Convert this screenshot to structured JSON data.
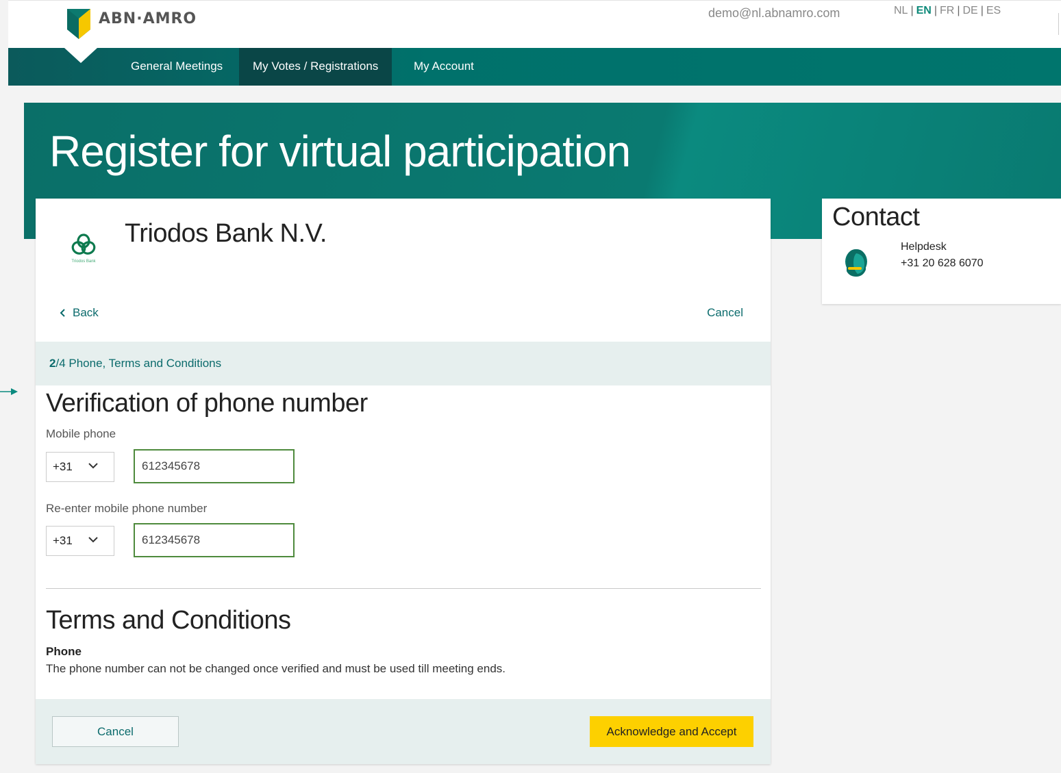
{
  "brand": {
    "name": "ABN·AMRO"
  },
  "header": {
    "user_email": "demo@nl.abnamro.com",
    "languages": [
      {
        "code": "NL",
        "active": false
      },
      {
        "code": "EN",
        "active": true
      },
      {
        "code": "FR",
        "active": false
      },
      {
        "code": "DE",
        "active": false
      },
      {
        "code": "ES",
        "active": false
      }
    ],
    "separator": "|"
  },
  "nav": {
    "items": [
      {
        "label": "General Meetings",
        "active": false
      },
      {
        "label": "My Votes / Registrations",
        "active": true
      },
      {
        "label": "My Account",
        "active": false
      }
    ]
  },
  "hero": {
    "title": "Register for virtual participation"
  },
  "card": {
    "bank_name": "Triodos Bank N.V.",
    "bank_logo_caption": "Triodos Bank",
    "back_label": "Back",
    "cancel_link_label": "Cancel",
    "step": {
      "current": "2",
      "total": "/4",
      "title": "Phone, Terms and Conditions"
    },
    "verification_title": "Verification of phone number",
    "mobile_label": "Mobile phone",
    "mobile_country_code": "+31",
    "mobile_value": "612345678",
    "reenter_label": "Re-enter mobile phone number",
    "reenter_country_code": "+31",
    "reenter_value": "612345678",
    "terms_title": "Terms and Conditions",
    "terms_subtitle": "Phone",
    "terms_text": "The phone number can not be changed once verified and must be used till meeting ends.",
    "cancel_button": "Cancel",
    "accept_button": "Acknowledge and Accept"
  },
  "contact": {
    "title": "Contact",
    "label": "Helpdesk",
    "phone": "+31 20 628 6070"
  },
  "colors": {
    "brand_green": "#00716b",
    "nav_active": "#0a4647",
    "accent_yellow": "#fdd000",
    "link": "#0b6b6c",
    "input_border_valid": "#4e8a3c"
  }
}
